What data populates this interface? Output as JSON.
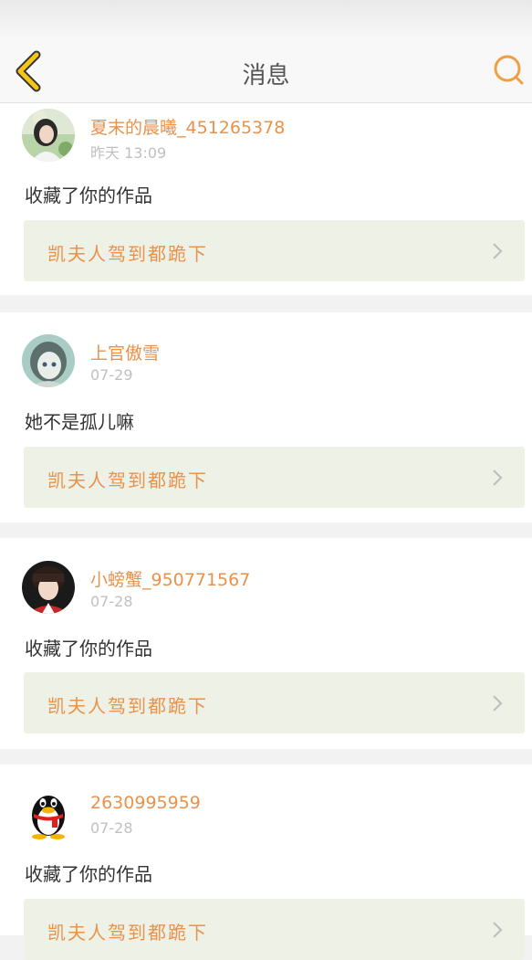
{
  "header": {
    "title": "消息",
    "back_icon": "chevron-left-icon",
    "search_icon": "search-icon",
    "accent": "#f0a044"
  },
  "messages": [
    {
      "user": "夏末的晨曦_451265378",
      "time": "昨天 13:09",
      "text": "收藏了你的作品",
      "work_title": "凯夫人驾到都跪下",
      "avatar": "photo-avatar"
    },
    {
      "user": "上官傲雪",
      "time": "07-29",
      "text": "她不是孤儿嘛",
      "work_title": "凯夫人驾到都跪下",
      "avatar": "anime-avatar"
    },
    {
      "user": "小螃蟹_950771567",
      "time": "07-28",
      "text": "收藏了你的作品",
      "work_title": "凯夫人驾到都跪下",
      "avatar": "photo-avatar"
    },
    {
      "user": "2630995959",
      "time": "07-28",
      "text": "收藏了你的作品",
      "work_title": "凯夫人驾到都跪下",
      "avatar": "qq-penguin-avatar"
    }
  ],
  "colors": {
    "name": "#e8924c",
    "time": "#c0c0c0",
    "work_bg": "#eef1e6",
    "separator": "#f2f2f2"
  }
}
